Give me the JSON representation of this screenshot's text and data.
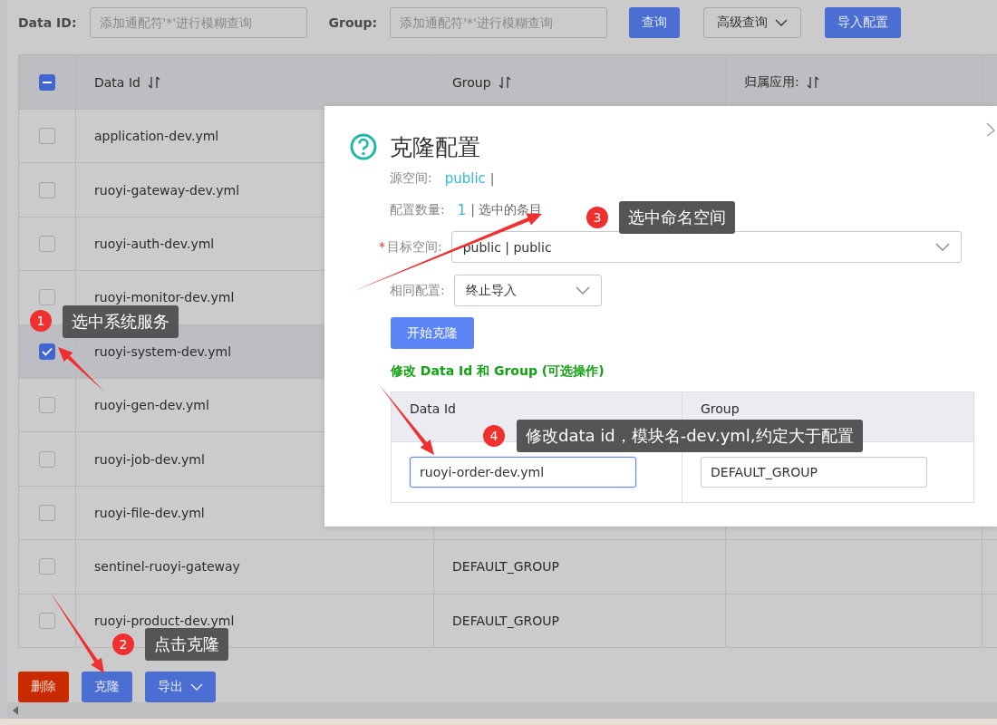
{
  "search_bar": {
    "fields": [
      {
        "label": "Data ID:",
        "placeholder": "添加通配符'*'进行模糊查询"
      },
      {
        "label": "Group:",
        "placeholder": "添加通配符'*'进行模糊查询"
      }
    ],
    "buttons": [
      {
        "label": "查询",
        "kind": "primary"
      },
      {
        "label": "高级查询",
        "kind": "dropdown"
      },
      {
        "label": "导入配置",
        "kind": "primary"
      }
    ]
  },
  "table": {
    "header_checkbox": {
      "indeterminate": true
    },
    "columns": [
      "Data Id",
      "Group",
      "归属应用:"
    ],
    "rows": [
      {
        "data_id": "application-dev.yml",
        "checked": false
      },
      {
        "data_id": "ruoyi-gateway-dev.yml",
        "checked": false
      },
      {
        "data_id": "ruoyi-auth-dev.yml",
        "checked": false
      },
      {
        "data_id": "ruoyi-monitor-dev.yml",
        "checked": false
      },
      {
        "data_id": "ruoyi-system-dev.yml",
        "checked": true
      },
      {
        "data_id": "ruoyi-gen-dev.yml",
        "checked": false
      },
      {
        "data_id": "ruoyi-job-dev.yml",
        "checked": false
      },
      {
        "data_id": "ruoyi-file-dev.yml",
        "checked": false
      },
      {
        "data_id": "sentinel-ruoyi-gateway",
        "group": "DEFAULT_GROUP",
        "checked": false
      },
      {
        "data_id": "ruoyi-product-dev.yml",
        "group": "DEFAULT_GROUP",
        "checked": false
      }
    ]
  },
  "bottom_buttons": [
    {
      "label": "删除",
      "kind": "danger"
    },
    {
      "label": "克隆",
      "kind": "primary"
    },
    {
      "label": "导出",
      "kind": "dropdown"
    }
  ],
  "dialog": {
    "title": "克隆配置",
    "source_space": {
      "label": "源空间:",
      "value": "public",
      "suffix": "|"
    },
    "count": {
      "label": "配置数量:",
      "value": "1",
      "suffix": "| 选中的条目"
    },
    "target_space": {
      "label": "目标空间:",
      "required": true,
      "required_mark": "*",
      "value": "public | public"
    },
    "same_config": {
      "label": "相同配置:",
      "value": "终止导入"
    },
    "start_button": "开始克隆",
    "edit_heading": "修改 Data Id 和 Group (可选操作)",
    "edit_table": {
      "columns": [
        "Data Id",
        "Group"
      ],
      "rows": [
        {
          "data_id": "ruoyi-order-dev.yml",
          "group": "DEFAULT_GROUP",
          "focused": true
        }
      ]
    }
  },
  "annotations": [
    {
      "number": "1",
      "text": "选中系统服务"
    },
    {
      "number": "2",
      "text": "点击克隆"
    },
    {
      "number": "3",
      "text": "选中命名空间"
    },
    {
      "number": "4",
      "text": "修改data id，模块名-dev.yml,约定大于配置"
    }
  ]
}
